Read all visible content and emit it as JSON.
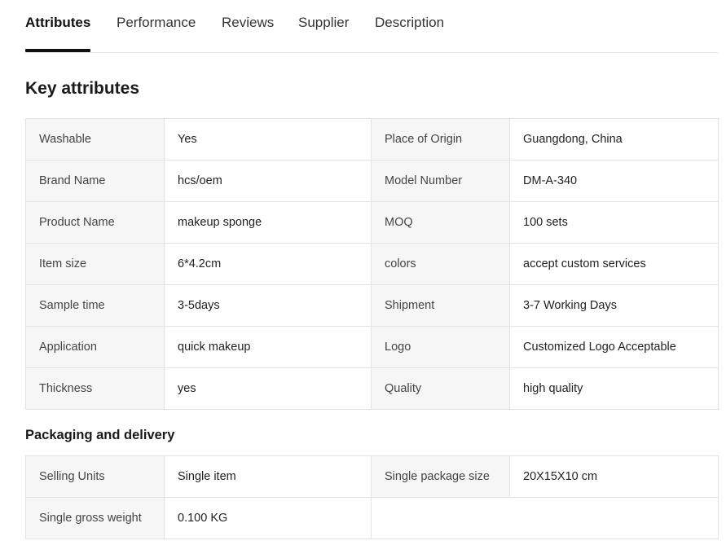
{
  "tabs": [
    {
      "label": "Attributes",
      "active": true
    },
    {
      "label": "Performance"
    },
    {
      "label": "Reviews"
    },
    {
      "label": "Supplier"
    },
    {
      "label": "Description"
    }
  ],
  "key_attributes": {
    "title": "Key attributes",
    "rows": [
      {
        "k1": "Washable",
        "v1": "Yes",
        "k2": "Place of Origin",
        "v2": "Guangdong, China"
      },
      {
        "k1": "Brand Name",
        "v1": "hcs/oem",
        "k2": "Model Number",
        "v2": "DM-A-340"
      },
      {
        "k1": "Product Name",
        "v1": "makeup sponge",
        "k2": "MOQ",
        "v2": "100 sets"
      },
      {
        "k1": "Item size",
        "v1": "6*4.2cm",
        "k2": "colors",
        "v2": "accept custom services"
      },
      {
        "k1": "Sample time",
        "v1": "3-5days",
        "k2": "Shipment",
        "v2": "3-7 Working Days"
      },
      {
        "k1": "Application",
        "v1": "quick makeup",
        "k2": "Logo",
        "v2": "Customized Logo Acceptable"
      },
      {
        "k1": "Thickness",
        "v1": "yes",
        "k2": "Quality",
        "v2": "high quality"
      }
    ]
  },
  "packaging": {
    "title": "Packaging and delivery",
    "rows": [
      {
        "k1": "Selling Units",
        "v1": "Single item",
        "k2": "Single package size",
        "v2": "20X15X10 cm"
      },
      {
        "k1": "Single gross weight",
        "v1": "0.100 KG",
        "k2": "",
        "v2": ""
      }
    ]
  }
}
